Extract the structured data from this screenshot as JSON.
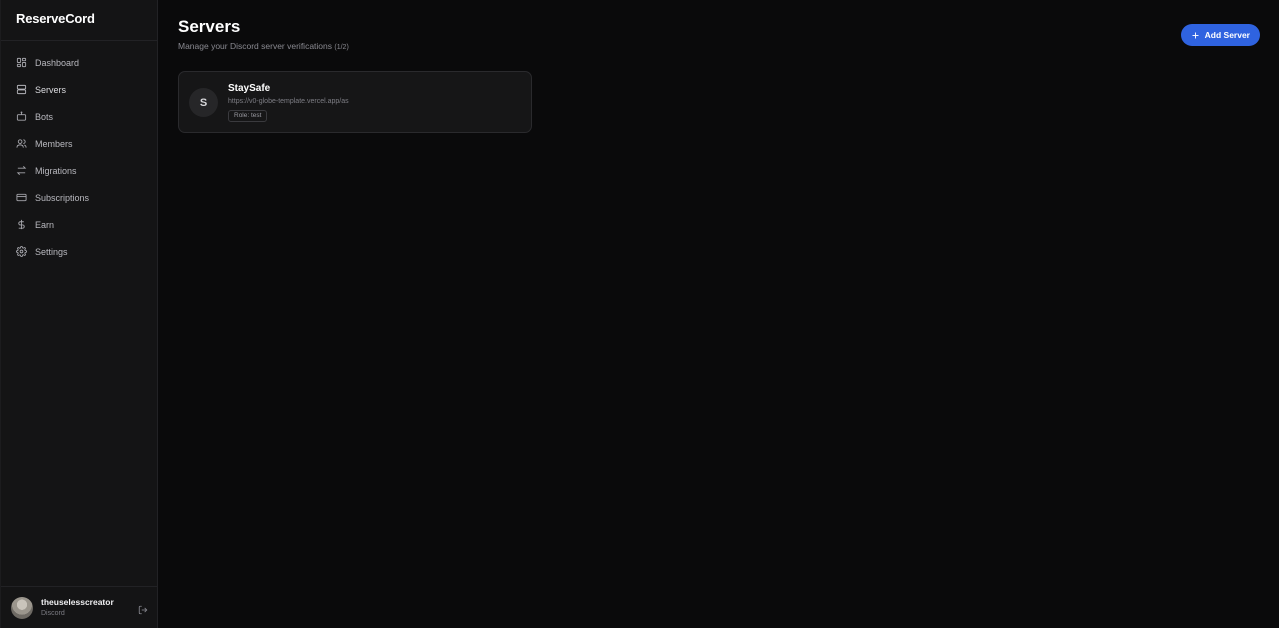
{
  "app": {
    "brand": "ReserveCord"
  },
  "sidebar": {
    "items": [
      {
        "label": "Dashboard",
        "icon": "dashboard-icon"
      },
      {
        "label": "Servers",
        "icon": "server-icon"
      },
      {
        "label": "Bots",
        "icon": "bot-icon"
      },
      {
        "label": "Members",
        "icon": "users-icon"
      },
      {
        "label": "Migrations",
        "icon": "arrows-swap-icon"
      },
      {
        "label": "Subscriptions",
        "icon": "credit-card-icon"
      },
      {
        "label": "Earn",
        "icon": "dollar-icon"
      },
      {
        "label": "Settings",
        "icon": "gear-icon"
      }
    ],
    "active": "Servers"
  },
  "user": {
    "name": "theuselesscreator",
    "provider": "Discord"
  },
  "page": {
    "title": "Servers",
    "subtitle": "Manage your Discord server verifications",
    "count": "(1/2)",
    "add_button": "Add Server"
  },
  "servers": [
    {
      "initial": "S",
      "name": "StaySafe",
      "url": "https://v0-globe-template.vercel.app/as",
      "role": "Role: test"
    }
  ],
  "colors": {
    "accent": "#2f63e0",
    "background": "#0a0a0b",
    "sidebar": "#141415"
  }
}
